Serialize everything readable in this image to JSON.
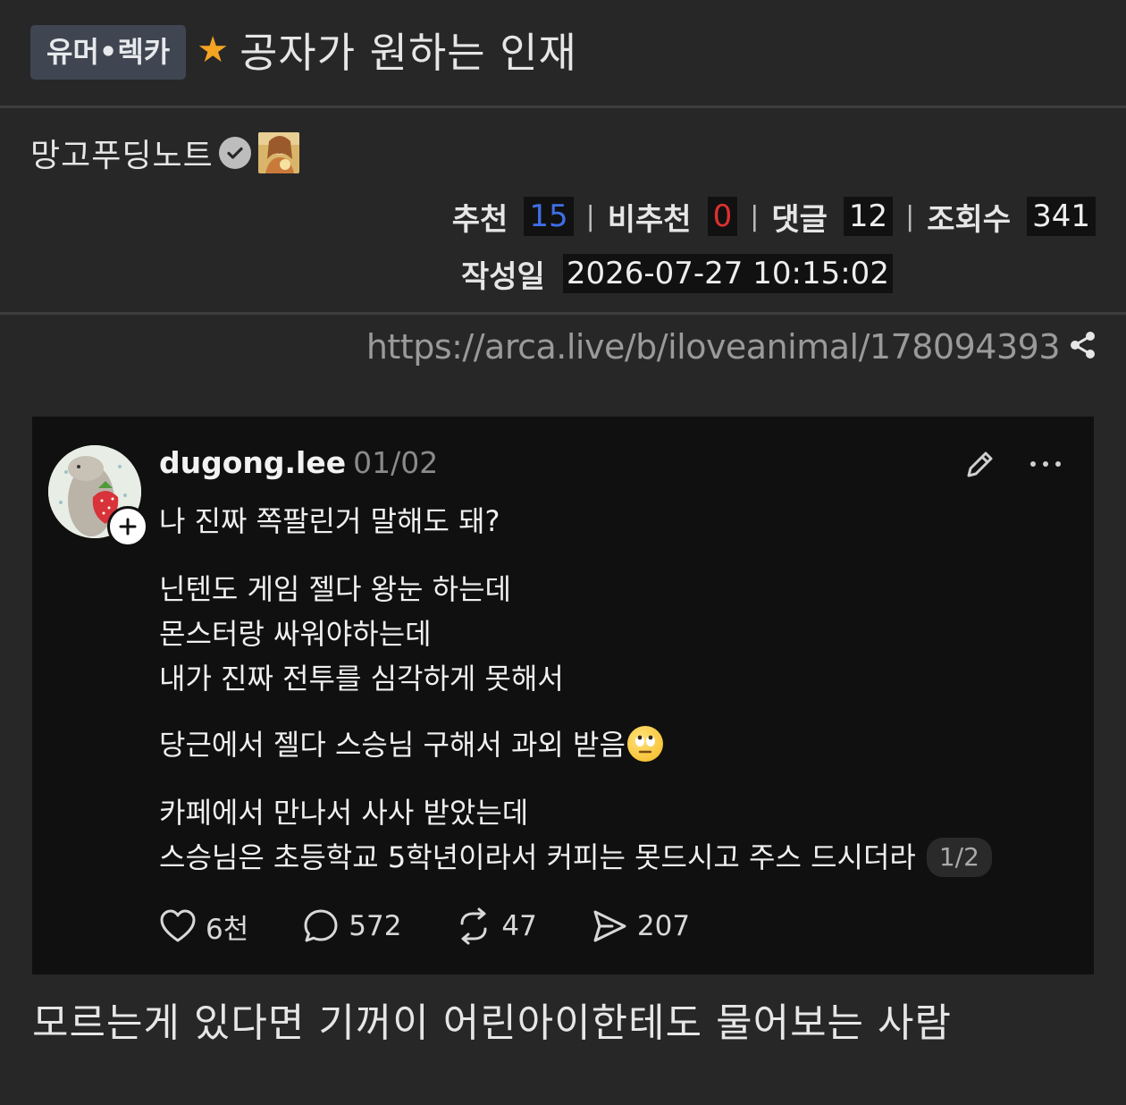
{
  "header": {
    "category_badge": "유머•렉카",
    "star_icon": "star-icon",
    "title": "공자가 원하는 인재"
  },
  "author": {
    "name": "망고푸딩노트",
    "verified_icon": "check-circle-icon"
  },
  "stats": {
    "recommend_label": "추천",
    "recommend_value": "15",
    "dislike_label": "비추천",
    "dislike_value": "0",
    "comments_label": "댓글",
    "comments_value": "12",
    "views_label": "조회수",
    "views_value": "341",
    "separator": "|"
  },
  "meta": {
    "date_label": "작성일",
    "date_value": "2026-07-27 10:15:02"
  },
  "link": {
    "url": "https://arca.live/b/iloveanimal/178094393",
    "share_icon": "share-icon"
  },
  "embedded_post": {
    "username": "dugong.lee",
    "date": "01/02",
    "lines": {
      "l1": "나 진짜 쪽팔린거 말해도 돼?",
      "l2": "닌텐도 게임 젤다 왕눈 하는데",
      "l3": "몬스터랑 싸워야하는데",
      "l4": "내가 진짜 전투를 심각하게 못해서",
      "l5": "당근에서 젤다 스승님 구해서 과외 받음",
      "l6": "카페에서 만나서 사사 받았는데",
      "l7": "스승님은 초등학교 5학년이라서 커피는 못드시고 주스 드시더라"
    },
    "pager": "1/2",
    "likes": "6천",
    "replies": "572",
    "reposts": "47",
    "shares": "207"
  },
  "caption": "모르는게 있다면 기꺼이 어린아이한테도 물어보는 사람",
  "colors": {
    "background": "#272727",
    "badge_bg": "#3f4652",
    "star": "#f4a423",
    "recommend": "#3f6fe6",
    "dislike": "#e03030",
    "card_bg": "#101010"
  }
}
